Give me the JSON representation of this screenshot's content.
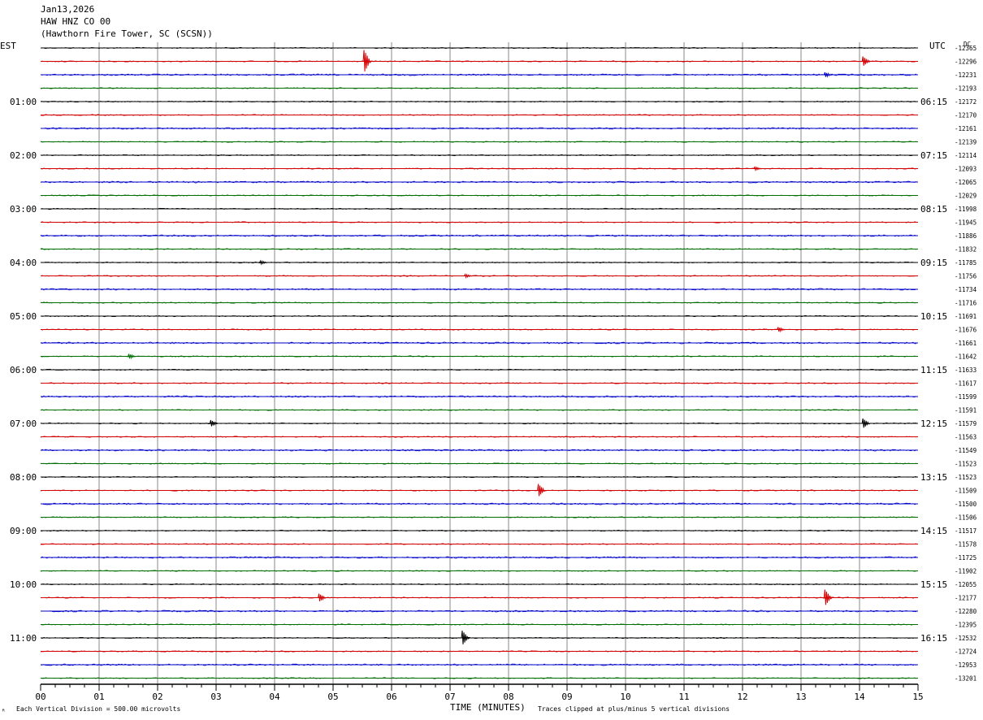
{
  "header": {
    "date": "Jan13,2026",
    "station": "HAW HNZ CO 00",
    "location": "(Hawthorn Fire Tower, SC (SCSN))",
    "left_tz": "EST",
    "right_tz": "UTC",
    "dc_label": "DC"
  },
  "footer": {
    "scale_note": "Each Vertical Division =  500.00 microvolts",
    "clip_note": "Traces clipped at plus/minus 5 vertical divisions",
    "corner_mark": "ᴿ"
  },
  "chart_data": {
    "type": "line",
    "title": "",
    "xlabel": "TIME (MINUTES)",
    "ylabel": "",
    "xlim": [
      0,
      15
    ],
    "x_ticks": [
      "00",
      "01",
      "02",
      "03",
      "04",
      "05",
      "06",
      "07",
      "08",
      "09",
      "10",
      "11",
      "12",
      "13",
      "14",
      "15"
    ],
    "grid": true,
    "trace_colors": [
      "#000000",
      "#d40000",
      "#0000c8",
      "#007000"
    ],
    "rows_per_hour": 4,
    "row_count": 48,
    "left_hour_labels": [
      "01:00",
      "02:00",
      "03:00",
      "04:00",
      "05:00",
      "06:00",
      "07:00",
      "08:00",
      "09:00",
      "10:00",
      "11:00"
    ],
    "right_hour_labels": [
      "06:15",
      "07:15",
      "08:15",
      "09:15",
      "10:15",
      "11:15",
      "12:15",
      "13:15",
      "14:15",
      "15:15",
      "16:15"
    ],
    "dc_offsets": [
      -12365,
      -12296,
      -12231,
      -12193,
      -12172,
      -12170,
      -12161,
      -12139,
      -12114,
      -12093,
      -12065,
      -12029,
      -11998,
      -11945,
      -11886,
      -11832,
      -11785,
      -11756,
      -11734,
      -11716,
      -11691,
      -11676,
      -11661,
      -11642,
      -11633,
      -11617,
      -11599,
      -11591,
      -11579,
      -11563,
      -11549,
      -11523,
      -11523,
      -11509,
      -11500,
      -11506,
      -11517,
      -11578,
      -11725,
      -11902,
      -12055,
      -12177,
      -12280,
      -12395,
      -12532,
      -12724,
      -12953,
      -13201
    ],
    "events": [
      {
        "row": 1,
        "minute": 5.57,
        "amplitude": 14
      },
      {
        "row": 1,
        "minute": 14.1,
        "amplitude": 6
      },
      {
        "row": 2,
        "minute": 13.45,
        "amplitude": 3
      },
      {
        "row": 9,
        "minute": 12.25,
        "amplitude": 2
      },
      {
        "row": 16,
        "minute": 3.8,
        "amplitude": 2
      },
      {
        "row": 17,
        "minute": 7.3,
        "amplitude": 2
      },
      {
        "row": 21,
        "minute": 12.65,
        "amplitude": 3
      },
      {
        "row": 23,
        "minute": 1.55,
        "amplitude": 3
      },
      {
        "row": 28,
        "minute": 2.95,
        "amplitude": 4
      },
      {
        "row": 28,
        "minute": 14.1,
        "amplitude": 6
      },
      {
        "row": 33,
        "minute": 8.55,
        "amplitude": 8
      },
      {
        "row": 41,
        "minute": 4.8,
        "amplitude": 5
      },
      {
        "row": 41,
        "minute": 13.45,
        "amplitude": 10
      },
      {
        "row": 44,
        "minute": 7.25,
        "amplitude": 9
      }
    ]
  }
}
